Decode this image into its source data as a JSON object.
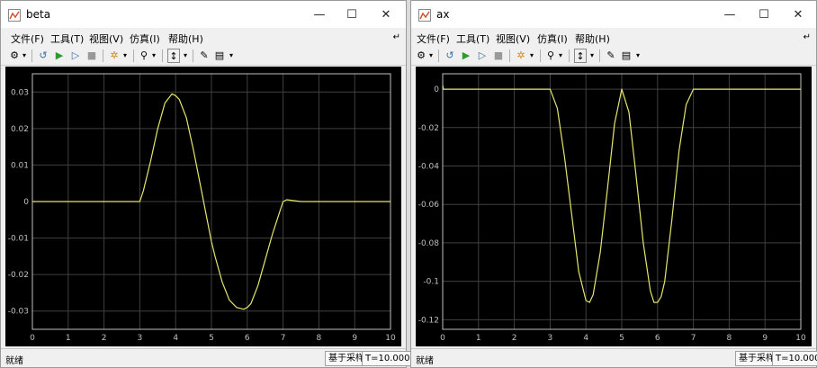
{
  "windows": [
    {
      "title": "beta",
      "menu": [
        "文件(F)",
        "工具(T)",
        "视图(V)",
        "仿真(I)",
        "帮助(H)"
      ],
      "status": "就绪",
      "sampling": "基于采样",
      "time": "T=10.000"
    },
    {
      "title": "ax",
      "menu": [
        "文件(F)",
        "工具(T)",
        "视图(V)",
        "仿真(I)",
        "帮助(H)"
      ],
      "status": "就绪",
      "sampling": "基于采样",
      "time": "T=10.000"
    }
  ],
  "colors": {
    "plot_bg": "#000000",
    "line": "#e6e66b",
    "axis": "#c0c0c0",
    "grid": "#404040"
  },
  "chart_data": [
    {
      "type": "line",
      "title": "",
      "xlabel": "",
      "ylabel": "",
      "xlim": [
        0,
        10
      ],
      "ylim": [
        -0.035,
        0.035
      ],
      "grid": true,
      "xticks": [
        0,
        1,
        2,
        3,
        4,
        5,
        6,
        7,
        8,
        9,
        10
      ],
      "yticks": [
        0.03,
        0.02,
        0.01,
        0,
        -0.01,
        -0.02,
        -0.03
      ],
      "xticklabels": [
        "0",
        "1",
        "2",
        "3",
        "4",
        "5",
        "6",
        "7",
        "8",
        "9",
        "10"
      ],
      "yticklabels": [
        "0.03",
        "0.02",
        "0.01",
        "0",
        "-0.01",
        "-0.02",
        "-0.03"
      ],
      "series": [
        {
          "x": [
            0,
            3.0,
            3.1,
            3.3,
            3.5,
            3.7,
            3.9,
            4.0,
            4.1,
            4.3,
            4.5,
            4.7,
            4.9,
            5.0,
            5.1,
            5.3,
            5.5,
            5.7,
            5.9,
            6.0,
            6.1,
            6.3,
            6.5,
            6.7,
            6.9,
            7.0,
            7.1,
            7.5,
            10
          ],
          "y": [
            0,
            0,
            0.003,
            0.011,
            0.02,
            0.027,
            0.0295,
            0.029,
            0.028,
            0.023,
            0.014,
            0.004,
            -0.006,
            -0.011,
            -0.015,
            -0.022,
            -0.027,
            -0.029,
            -0.0295,
            -0.029,
            -0.028,
            -0.023,
            -0.016,
            -0.009,
            -0.003,
            0,
            0.0005,
            0,
            0
          ]
        }
      ]
    },
    {
      "type": "line",
      "title": "",
      "xlabel": "",
      "ylabel": "",
      "xlim": [
        0,
        10
      ],
      "ylim": [
        -0.125,
        0.008
      ],
      "grid": true,
      "xticks": [
        0,
        1,
        2,
        3,
        4,
        5,
        6,
        7,
        8,
        9,
        10
      ],
      "yticks": [
        0,
        -0.02,
        -0.04,
        -0.06,
        -0.08,
        -0.1,
        -0.12
      ],
      "xticklabels": [
        "0",
        "1",
        "2",
        "3",
        "4",
        "5",
        "6",
        "7",
        "8",
        "9",
        "10"
      ],
      "yticklabels": [
        "0",
        "-0.02",
        "-0.04",
        "-0.06",
        "-0.08",
        "-0.1",
        "-0.12"
      ],
      "series": [
        {
          "x": [
            0,
            0.02,
            0.05,
            3.0,
            3.2,
            3.4,
            3.6,
            3.8,
            4.0,
            4.1,
            4.2,
            4.4,
            4.6,
            4.8,
            5.0,
            5.2,
            5.4,
            5.6,
            5.8,
            5.9,
            6.0,
            6.1,
            6.2,
            6.4,
            6.6,
            6.8,
            7.0,
            10
          ],
          "y": [
            0.002,
            0,
            0,
            0,
            -0.01,
            -0.035,
            -0.065,
            -0.095,
            -0.11,
            -0.111,
            -0.107,
            -0.085,
            -0.052,
            -0.018,
            0,
            -0.012,
            -0.045,
            -0.08,
            -0.105,
            -0.111,
            -0.111,
            -0.108,
            -0.1,
            -0.068,
            -0.032,
            -0.008,
            0,
            0
          ]
        }
      ]
    }
  ]
}
